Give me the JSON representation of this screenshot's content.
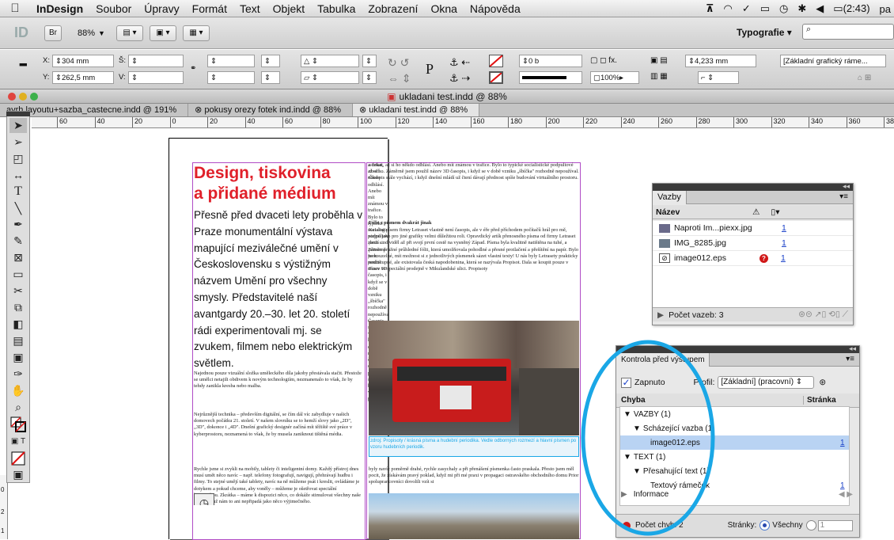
{
  "menubar": {
    "app": "InDesign",
    "items": [
      "Soubor",
      "Úpravy",
      "Formát",
      "Text",
      "Objekt",
      "Tabulka",
      "Zobrazení",
      "Okna",
      "Nápověda"
    ],
    "battery": "(2:43)",
    "tail": "pa"
  },
  "appbar": {
    "zoom": "88%",
    "bridge": "Br",
    "workspace": "Typografie"
  },
  "control": {
    "x_label": "X:",
    "x_value": "304 mm",
    "y_label": "Y:",
    "y_value": "262,5 mm",
    "w_label": "Š:",
    "h_label": "V:",
    "stroke_weight": "0 b",
    "opacity": "100%",
    "gutter": "4,233 mm",
    "object_style": "[Základní grafický ráme..."
  },
  "document": {
    "title": "ukladani test.indd @ 88%",
    "tabs": [
      {
        "label": "avrh layoutu+sazba_castecne.indd @ 191%"
      },
      {
        "label": "pokusy orezy fotek ind.indd @ 88%"
      },
      {
        "label": "ukladani test.indd @ 88%"
      }
    ],
    "ruler_ticks": [
      "60",
      "40",
      "20",
      "0",
      "20",
      "40",
      "60",
      "80",
      "100",
      "120",
      "140",
      "160",
      "180",
      "200",
      "220",
      "240",
      "260",
      "280",
      "300",
      "320",
      "340",
      "360",
      "380"
    ],
    "vruler_ticks": [
      "0",
      "2",
      "1"
    ]
  },
  "article": {
    "headline1": "Design, tiskovina",
    "headline2": "a přidané médium",
    "lead": "Přesně před dvaceti lety proběhla v Praze monumentální výstava mapující meziválečné umění v Československu s výstižným názvem Umění pro všechny smysly. Představitelé naší avantgardy 20.–30. let 20. století rádi experimentovali mj. se zvukem, filmem nebo elektrickým světlem.",
    "p1": "Najednou pouze vizuální složka uměleckého díla jakoby přestávala stačit. Přestože se umělci netajili obdivem k novým technologiím, nezmanenalo to však, že by tehdy zanikla kresba nebo malba.",
    "p2": "Nejrůznější technika – především digitální, se čím dál víc zabydluje v našich domovech počátku 21. století. V našem slovníku se to hemží slovy jako „2D\", „3D\", dokonce i „4D\". Dnešní grafický designér začíná mít těžiště své práce v kyberprostoru, neznamená to však, že by musela zaniknout tištěná média.",
    "p3": "Rychle jsme si zvykli na mobily, tablety či inteligentní domy. Každý přístroj dnes musí umět něco navíc – např. telefony fotografují, navigují, přehrávají hudbu i filmy. To stejné umějí také tablety, navíc na ně můžeme psát i kreslit, ovládáme je dotykem a pokud chceme, aby voněly – můžeme je ošetřovat speciální kosmetikou. Zkrátka – máme k dispozici něco, co dokáže stimulovat všechny naše smysly a už nám to ani nepřipadá jako něco výjimečného.",
    "r1": "a čekat, až si ho někdo odhlásí. Anebo mít známou v trafice. Bylo to typické socialistické podpultové zboží ... Záměrně jsem použil název 3D časopis, i když se v době vzniku „šbíčka\" rozhodně nepoužíval. Časopis stále vychází, i když dnešní mládí už čtení dávají přednost spíše budování virtuálního prostoru.",
    "r2": "Fólie s písmem dvakrát jinak",
    "r3": "Katalog písem firmy Letraset vlastně není časopis, ale v éře před příchodem počítačů hrál pro mě, stejně jako pro jiné grafiky velmi důležitou roli. Opravdický artík přenosného písma od firmy Letraset jsem sind viděl až při svojí první cestě na vysněný Západ. Písma byla kvalitně natištěna na tuhé, a přitom pružné průhledné fólii, která umožňovala pohodlné a přesné protlačení a přešítění na papír. Bylo to kouzelné, mít možnost si z jednotlivých písmenek sázet vlastní texty! U nás byly Letrasety prakticky nedostupné, ale existovala česká napodobenina, která se nazývala Propisot. Dala se koupit pouze v Praze ve speciální prodejně v Mikulandské ulici. Propisoty",
    "caption": "zdroj: Propisoty / krásná písma a hudební periodika. Vedle odborných rozmezí a hlavní písmen po vzoru hudebních periodik.",
    "r4": "byly navíc poměrně drahé, rychle zasychaly a při přenášení písmenka často praskala. Přesto jsem měl pocit, že získávám pravý poklad, když mi při mé praxi v propagaci ostravského obchodního domu Prior spoluprancovníci dovolili vzít si"
  },
  "links_panel": {
    "tab": "Vazby",
    "col_name": "Název",
    "items": [
      {
        "name": "Naproti Im...piexx.jpg",
        "page": "1",
        "missing": false
      },
      {
        "name": "IMG_8285.jpg",
        "page": "1",
        "missing": false
      },
      {
        "name": "image012.eps",
        "page": "1",
        "missing": true
      }
    ],
    "count": "Počet vazeb: 3"
  },
  "preflight_panel": {
    "tab": "Kontrola před výstupem",
    "enabled_label": "Zapnuto",
    "profile_label": "Profil:",
    "profile_value": "[Základní] (pracovní)",
    "col_error": "Chyba",
    "col_page": "Stránka",
    "rows": [
      {
        "label": "VAZBY (1)",
        "indent": 0,
        "page": ""
      },
      {
        "label": "Scházející vazba (1)",
        "indent": 1,
        "page": ""
      },
      {
        "label": "image012.eps",
        "indent": 2,
        "page": "1"
      },
      {
        "label": "TEXT (1)",
        "indent": 0,
        "page": ""
      },
      {
        "label": "Přesahující text (1)",
        "indent": 1,
        "page": ""
      },
      {
        "label": "Textový rámeček",
        "indent": 2,
        "page": "1"
      }
    ],
    "info": "Informace",
    "error_count": "Počet chyb: 2",
    "pages_label": "Stránky:",
    "pages_all": "Všechny",
    "pages_range": "1"
  },
  "colors": {
    "headline": "#e0202a",
    "highlight": "#1aa7e6",
    "link": "#1a40c8"
  }
}
